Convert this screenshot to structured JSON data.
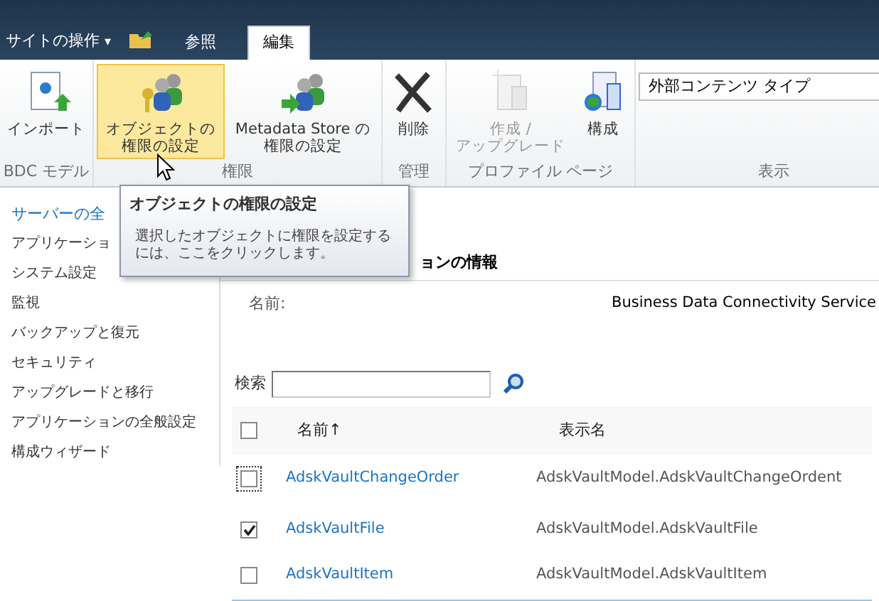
{
  "top_bar": {
    "site_actions": {
      "label": "サイトの操作",
      "caret": "▾"
    },
    "tabs": [
      {
        "label": "参照",
        "selected": false
      },
      {
        "label": "編集",
        "selected": true
      }
    ]
  },
  "ribbon": {
    "groups": [
      {
        "label": "BDC モデル",
        "items": [
          {
            "kind": "import",
            "label": "インポート",
            "selected": false,
            "disabled": false
          }
        ]
      },
      {
        "label": "権限",
        "items": [
          {
            "kind": "object-permission",
            "label": "オブジェクトの権限の設定",
            "selected": true,
            "disabled": false
          },
          {
            "kind": "store-permission",
            "label": "Metadata Store の権限の設定",
            "selected": false,
            "disabled": false
          }
        ]
      },
      {
        "label": "管理",
        "items": [
          {
            "kind": "delete",
            "label": "削除",
            "selected": false,
            "disabled": false
          }
        ]
      },
      {
        "label": "プロファイル ページ",
        "items": [
          {
            "kind": "create",
            "label": "作成 / アップグレード",
            "selected": false,
            "disabled": true
          },
          {
            "kind": "configure",
            "label": "構成",
            "selected": false,
            "disabled": false
          }
        ]
      },
      {
        "label": "表示",
        "items": [
          {
            "kind": "select",
            "label": "外部コンテンツ タイプ"
          }
        ]
      }
    ]
  },
  "tooltip": {
    "title": "オブジェクトの権限の設定",
    "body": "選択したオブジェクトに権限を設定するには、ここをクリックします。"
  },
  "sidebar": {
    "items": [
      {
        "label": "サーバーの全",
        "selected": true
      },
      {
        "label": "アプリケーショ",
        "selected": false
      },
      {
        "label": "システム設定",
        "selected": false
      },
      {
        "label": "監視",
        "selected": false
      },
      {
        "label": "バックアップと復元",
        "selected": false
      },
      {
        "label": "セキュリティ",
        "selected": false
      },
      {
        "label": "アップグレードと移行",
        "selected": false
      },
      {
        "label": "アプリケーションの全般設定",
        "selected": false
      },
      {
        "label": "構成ウィザード",
        "selected": false
      }
    ]
  },
  "main": {
    "heading": "ョンの情報",
    "fields": [
      {
        "label": "名前:",
        "value": "Business Data Connectivity Service"
      }
    ],
    "search": {
      "label": "検索"
    },
    "table": {
      "header_checked": false,
      "columns": [
        "名前↑",
        "表示名"
      ],
      "rows": [
        {
          "name": "AdskVaultChangeOrder",
          "display_name": "AdskVaultModel.AdskVaultChangeOrdent",
          "checked": false,
          "focused": true
        },
        {
          "name": "AdskVaultFile",
          "display_name": "AdskVaultModel.AdskVaultFile",
          "checked": true,
          "focused": false
        },
        {
          "name": "AdskVaultItem",
          "display_name": "AdskVaultModel.AdskVaultItem",
          "checked": false,
          "focused": false
        }
      ]
    }
  }
}
